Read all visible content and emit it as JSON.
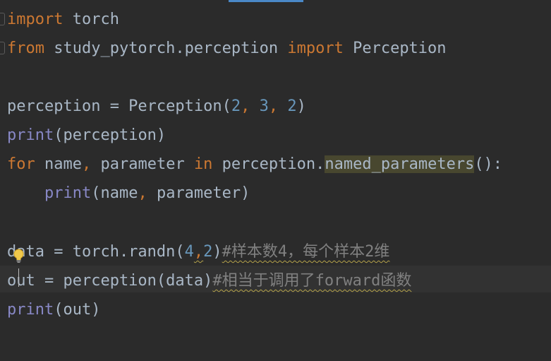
{
  "editor": {
    "lines": {
      "l1": {
        "kw_import": "import",
        "rest": " torch"
      },
      "l2": {
        "kw_from": "from",
        "module": " study_pytorch.perception ",
        "kw_import": "import",
        "cls": " Perception"
      },
      "l4": {
        "pre": "perception = Perception(",
        "n1": "2",
        "c1": ", ",
        "n2": "3",
        "c2": ", ",
        "n3": "2",
        "post": ")"
      },
      "l5": {
        "fn": "print",
        "rest": "(perception)"
      },
      "l6": {
        "kw_for": "for",
        "a": " name",
        "comma": ",",
        "b": " parameter ",
        "kw_in": "in",
        "c": " perception.",
        "method": "named_parameters",
        "post": "():"
      },
      "l7": {
        "indent": "    ",
        "fn": "print",
        "a": "(name",
        "comma": ",",
        "b": " parameter)"
      },
      "l9": {
        "pre": "data = torch.randn(",
        "n1": "4",
        "comma": ",",
        "n2": "2",
        "post": ")",
        "comment": "#样本数4，每个样本2维"
      },
      "l10": {
        "pre": "out = perception(data)",
        "comment": "#相当于调用了forward函数"
      },
      "l11": {
        "fn": "print",
        "rest": "(out)"
      }
    }
  },
  "colors": {
    "background": "#2b2b2b",
    "keyword": "#cc7832",
    "builtin": "#8888c6",
    "number": "#6897bb",
    "comment": "#808080",
    "text": "#a9b7c6",
    "usage_highlight": "#48472f"
  },
  "icons": {
    "intention": "lightbulb-icon"
  }
}
